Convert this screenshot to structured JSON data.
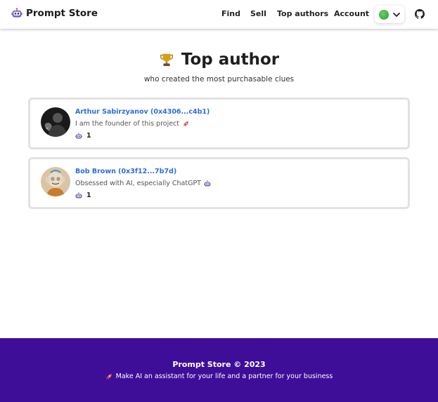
{
  "brand": {
    "name": "Prompt Store",
    "icon": "robot-icon"
  },
  "nav": {
    "find": "Find",
    "sell": "Sell",
    "top_authors": "Top authors",
    "account": "Account"
  },
  "header": {
    "title": "Top author",
    "subtitle": "who created the most purchasable clues",
    "icon": "trophy-icon"
  },
  "authors": [
    {
      "name": "Arthur Sabirzyanov (0x4306...c4b1)",
      "bio": "I am the founder of this project",
      "bio_icon": "rocket-icon",
      "count": "1"
    },
    {
      "name": "Bob Brown (0x3f12...7b7d)",
      "bio": "Obsessed with AI, especially ChatGPT",
      "bio_icon": "robot-icon",
      "count": "1"
    }
  ],
  "footer": {
    "title": "Prompt Store © 2023",
    "tagline": "Make AI an assistant for your life and a partner for your business",
    "icon": "rocket-icon"
  },
  "colors": {
    "accent": "#2f6ed8",
    "footer_bg": "#3e0e98"
  }
}
